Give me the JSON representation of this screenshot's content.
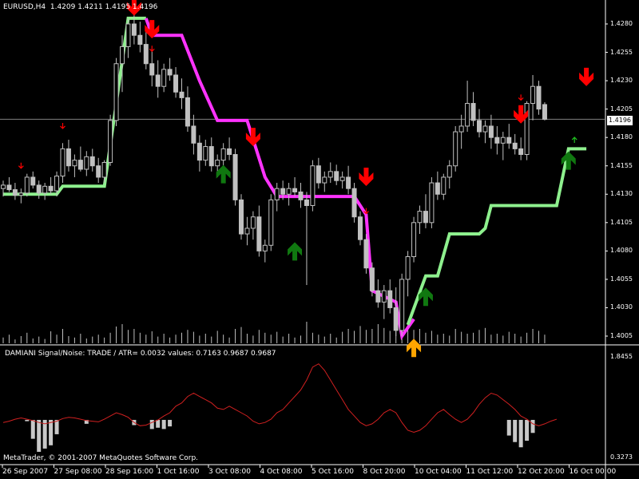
{
  "chart_data": {
    "type": "candlestick",
    "header": {
      "symbol": "EURUSD,H4",
      "ohlc": "1.4209 1.4211 1.4195 1.4196"
    },
    "current_price": "1.4196",
    "current_value": 1.4196,
    "price_axis": {
      "ticks": [
        "1.4280",
        "1.4255",
        "1.4230",
        "1.4205",
        "1.4180",
        "1.4155",
        "1.4130",
        "1.4105",
        "1.4080",
        "1.4055",
        "1.4030",
        "1.4005"
      ],
      "values": [
        1.428,
        1.4255,
        1.423,
        1.4205,
        1.418,
        1.4155,
        1.413,
        1.4105,
        1.408,
        1.4055,
        1.403,
        1.4005
      ]
    },
    "time_axis": [
      "26 Sep 2007",
      "27 Sep 08:00",
      "28 Sep 16:00",
      "1 Oct 16:00",
      "3 Oct 08:00",
      "4 Oct 08:00",
      "5 Oct 16:00",
      "8 Oct 20:00",
      "10 Oct 04:00",
      "11 Oct 12:00",
      "12 Oct 20:00",
      "16 Oct 00:00"
    ],
    "candles": [
      [
        1.4135,
        1.4142,
        1.4128,
        1.4138
      ],
      [
        1.4138,
        1.4145,
        1.4132,
        1.4134
      ],
      [
        1.4134,
        1.414,
        1.4125,
        1.4129
      ],
      [
        1.4129,
        1.4135,
        1.4122,
        1.4131
      ],
      [
        1.4131,
        1.4148,
        1.4128,
        1.4145
      ],
      [
        1.4145,
        1.415,
        1.4135,
        1.4138
      ],
      [
        1.4138,
        1.4142,
        1.4126,
        1.4131
      ],
      [
        1.4131,
        1.414,
        1.4125,
        1.4137
      ],
      [
        1.4137,
        1.4145,
        1.413,
        1.4133
      ],
      [
        1.4133,
        1.415,
        1.4128,
        1.4146
      ],
      [
        1.4146,
        1.4175,
        1.414,
        1.417
      ],
      [
        1.417,
        1.4178,
        1.415,
        1.4155
      ],
      [
        1.4155,
        1.4165,
        1.4145,
        1.416
      ],
      [
        1.416,
        1.4172,
        1.415,
        1.4152
      ],
      [
        1.4152,
        1.4168,
        1.4146,
        1.4163
      ],
      [
        1.4163,
        1.417,
        1.415,
        1.4155
      ],
      [
        1.4155,
        1.4162,
        1.414,
        1.4145
      ],
      [
        1.4145,
        1.416,
        1.414,
        1.4158
      ],
      [
        1.4158,
        1.42,
        1.4155,
        1.4195
      ],
      [
        1.4195,
        1.425,
        1.419,
        1.4245
      ],
      [
        1.4245,
        1.427,
        1.422,
        1.426
      ],
      [
        1.426,
        1.4285,
        1.425,
        1.428
      ],
      [
        1.428,
        1.429,
        1.4262,
        1.427
      ],
      [
        1.427,
        1.4282,
        1.4255,
        1.4262
      ],
      [
        1.4262,
        1.4275,
        1.424,
        1.4245
      ],
      [
        1.4245,
        1.4258,
        1.4225,
        1.4235
      ],
      [
        1.4235,
        1.4248,
        1.4215,
        1.4225
      ],
      [
        1.4225,
        1.4245,
        1.422,
        1.424
      ],
      [
        1.424,
        1.425,
        1.423,
        1.4235
      ],
      [
        1.4235,
        1.4242,
        1.4215,
        1.422
      ],
      [
        1.422,
        1.4232,
        1.4205,
        1.4215
      ],
      [
        1.4215,
        1.4225,
        1.4185,
        1.419
      ],
      [
        1.419,
        1.42,
        1.4165,
        1.4175
      ],
      [
        1.4175,
        1.4182,
        1.415,
        1.416
      ],
      [
        1.416,
        1.4178,
        1.4155,
        1.4172
      ],
      [
        1.4172,
        1.418,
        1.415,
        1.4155
      ],
      [
        1.4155,
        1.4165,
        1.4145,
        1.416
      ],
      [
        1.416,
        1.4175,
        1.4155,
        1.417
      ],
      [
        1.417,
        1.418,
        1.416,
        1.4165
      ],
      [
        1.4165,
        1.417,
        1.412,
        1.4125
      ],
      [
        1.4125,
        1.413,
        1.409,
        1.4095
      ],
      [
        1.4095,
        1.411,
        1.4085,
        1.41
      ],
      [
        1.41,
        1.4115,
        1.409,
        1.411
      ],
      [
        1.411,
        1.412,
        1.4075,
        1.408
      ],
      [
        1.408,
        1.409,
        1.407,
        1.4085
      ],
      [
        1.4085,
        1.413,
        1.408,
        1.4125
      ],
      [
        1.4125,
        1.414,
        1.4115,
        1.4135
      ],
      [
        1.4135,
        1.4142,
        1.4125,
        1.413
      ],
      [
        1.413,
        1.414,
        1.412,
        1.4135
      ],
      [
        1.4135,
        1.4145,
        1.4128,
        1.4132
      ],
      [
        1.4132,
        1.414,
        1.4118,
        1.4125
      ],
      [
        1.4125,
        1.4132,
        1.405,
        1.412
      ],
      [
        1.412,
        1.416,
        1.4115,
        1.4155
      ],
      [
        1.4155,
        1.4162,
        1.4135,
        1.414
      ],
      [
        1.414,
        1.415,
        1.4132,
        1.4145
      ],
      [
        1.4145,
        1.4158,
        1.414,
        1.415
      ],
      [
        1.415,
        1.4156,
        1.4138,
        1.4142
      ],
      [
        1.4142,
        1.415,
        1.4135,
        1.4145
      ],
      [
        1.4145,
        1.4155,
        1.413,
        1.4135
      ],
      [
        1.4135,
        1.414,
        1.4105,
        1.411
      ],
      [
        1.411,
        1.4115,
        1.4085,
        1.409
      ],
      [
        1.409,
        1.4095,
        1.406,
        1.4065
      ],
      [
        1.4065,
        1.407,
        1.404,
        1.4045
      ],
      [
        1.4045,
        1.4055,
        1.403,
        1.4035
      ],
      [
        1.4035,
        1.405,
        1.402,
        1.4045
      ],
      [
        1.4045,
        1.4055,
        1.4025,
        1.403
      ],
      [
        1.403,
        1.4048,
        1.4005,
        1.401
      ],
      [
        1.401,
        1.406,
        1.4005,
        1.4055
      ],
      [
        1.4055,
        1.408,
        1.404,
        1.4075
      ],
      [
        1.4075,
        1.411,
        1.407,
        1.4105
      ],
      [
        1.4105,
        1.412,
        1.4095,
        1.4115
      ],
      [
        1.4115,
        1.413,
        1.41,
        1.4105
      ],
      [
        1.4105,
        1.4145,
        1.41,
        1.414
      ],
      [
        1.414,
        1.415,
        1.4125,
        1.413
      ],
      [
        1.413,
        1.4148,
        1.4125,
        1.4145
      ],
      [
        1.4145,
        1.416,
        1.4135,
        1.4155
      ],
      [
        1.4155,
        1.419,
        1.415,
        1.4185
      ],
      [
        1.4185,
        1.42,
        1.417,
        1.419
      ],
      [
        1.419,
        1.423,
        1.4185,
        1.421
      ],
      [
        1.421,
        1.422,
        1.419,
        1.4195
      ],
      [
        1.4195,
        1.4205,
        1.418,
        1.4185
      ],
      [
        1.4185,
        1.4195,
        1.4175,
        1.419
      ],
      [
        1.419,
        1.42,
        1.417,
        1.418
      ],
      [
        1.418,
        1.419,
        1.4165,
        1.4175
      ],
      [
        1.4175,
        1.4185,
        1.416,
        1.418
      ],
      [
        1.418,
        1.4192,
        1.417,
        1.4175
      ],
      [
        1.4175,
        1.4183,
        1.4165,
        1.417
      ],
      [
        1.417,
        1.418,
        1.416,
        1.4165
      ],
      [
        1.4165,
        1.4212,
        1.416,
        1.421
      ],
      [
        1.421,
        1.4235,
        1.4195,
        1.4225
      ],
      [
        1.4225,
        1.423,
        1.42,
        1.4205
      ],
      [
        1.4209,
        1.4211,
        1.4195,
        1.4196
      ]
    ],
    "stop_lines": [
      {
        "name": "support",
        "color": "#8ef08e",
        "points": [
          [
            0,
            1.413
          ],
          [
            9,
            1.413
          ],
          [
            10,
            1.4137
          ],
          [
            17,
            1.4137
          ],
          [
            19,
            1.421
          ],
          [
            21,
            1.4285
          ],
          [
            24,
            1.4285
          ]
        ]
      },
      {
        "name": "resistance",
        "color": "#ff33ff",
        "points": [
          [
            24,
            1.4285
          ],
          [
            25,
            1.427
          ],
          [
            30,
            1.427
          ],
          [
            33,
            1.423
          ],
          [
            36,
            1.4195
          ],
          [
            41,
            1.4195
          ],
          [
            44,
            1.4145
          ],
          [
            46,
            1.4128
          ],
          [
            59,
            1.4128
          ],
          [
            61,
            1.4112
          ],
          [
            62,
            1.4045
          ],
          [
            66,
            1.4035
          ],
          [
            67,
            1.4005
          ],
          [
            69,
            1.402
          ]
        ]
      },
      {
        "name": "support2",
        "color": "#8ef08e",
        "points": [
          [
            68,
            1.4015
          ],
          [
            71,
            1.4058
          ],
          [
            73,
            1.4058
          ],
          [
            75,
            1.4095
          ],
          [
            80,
            1.4095
          ],
          [
            81,
            1.41
          ],
          [
            82,
            1.412
          ],
          [
            93,
            1.412
          ],
          [
            95,
            1.417
          ],
          [
            98,
            1.417
          ]
        ]
      }
    ],
    "signals": [
      {
        "i": 3,
        "type": "sell-small",
        "price": 1.4155
      },
      {
        "i": 10,
        "type": "sell-small",
        "price": 1.419
      },
      {
        "i": 22,
        "type": "sell",
        "price": 1.4295
      },
      {
        "i": 25,
        "type": "sell",
        "price": 1.4275
      },
      {
        "i": 25,
        "type": "sell-small",
        "price": 1.4258
      },
      {
        "i": 37,
        "type": "buy",
        "price": 1.4148
      },
      {
        "i": 42,
        "type": "sell",
        "price": 1.418
      },
      {
        "i": 49,
        "type": "buy",
        "price": 1.408
      },
      {
        "i": 61,
        "type": "sell",
        "price": 1.4145
      },
      {
        "i": 61,
        "type": "sell-small",
        "price": 1.4115
      },
      {
        "i": 69,
        "type": "buy-orange",
        "price": 1.3995
      },
      {
        "i": 71,
        "type": "buy",
        "price": 1.404
      },
      {
        "i": 87,
        "type": "sell-small",
        "price": 1.4215
      },
      {
        "i": 87,
        "type": "sell",
        "price": 1.42
      },
      {
        "i": 95,
        "type": "buy",
        "price": 1.416
      },
      {
        "i": 96,
        "type": "buy-small",
        "price": 1.4178
      },
      {
        "i": 98,
        "type": "sell",
        "price": 1.4233
      }
    ],
    "volume": [
      12,
      18,
      8,
      15,
      22,
      10,
      14,
      9,
      25,
      18,
      30,
      15,
      12,
      20,
      10,
      14,
      18,
      12,
      22,
      35,
      40,
      28,
      30,
      22,
      18,
      25,
      14,
      20,
      12,
      18,
      22,
      28,
      24,
      16,
      20,
      14,
      26,
      18,
      12,
      30,
      34,
      20,
      16,
      28,
      22,
      18,
      24,
      14,
      20,
      12,
      16,
      45,
      22,
      18,
      14,
      20,
      12,
      24,
      30,
      26,
      36,
      28,
      30,
      40,
      32,
      26,
      34,
      38,
      40,
      28,
      30,
      22,
      26,
      18,
      20,
      16,
      30,
      24,
      20,
      22,
      28,
      32,
      18,
      20,
      16,
      24,
      20,
      14,
      22,
      30,
      26,
      18,
      12,
      10
    ],
    "indicator": {
      "title": "DAMIANI Signal/Noise: TRADE  /  ATR= 0.0032     values: 0.7163 0.9687 0.9687",
      "ticks": [
        "1.8455",
        "0.3273"
      ],
      "range": [
        0.3273,
        1.8455
      ],
      "line_color": "#d02020",
      "line": [
        0.9,
        0.92,
        0.95,
        0.97,
        0.95,
        0.93,
        0.9,
        0.88,
        0.9,
        0.92,
        0.96,
        0.98,
        0.97,
        0.95,
        0.93,
        0.92,
        0.91,
        0.95,
        1.0,
        1.05,
        1.02,
        0.98,
        0.9,
        0.85,
        0.86,
        0.9,
        0.94,
        1.0,
        1.05,
        1.15,
        1.2,
        1.3,
        1.35,
        1.3,
        1.25,
        1.2,
        1.12,
        1.1,
        1.15,
        1.1,
        1.05,
        1.0,
        0.92,
        0.88,
        0.9,
        0.95,
        1.05,
        1.1,
        1.2,
        1.3,
        1.4,
        1.55,
        1.75,
        1.8,
        1.7,
        1.55,
        1.4,
        1.25,
        1.1,
        1.0,
        0.9,
        0.85,
        0.88,
        0.95,
        1.05,
        1.1,
        1.05,
        0.9,
        0.78,
        0.75,
        0.78,
        0.85,
        0.95,
        1.05,
        1.1,
        1.02,
        0.95,
        0.9,
        0.95,
        1.05,
        1.18,
        1.28,
        1.35,
        1.32,
        1.25,
        1.18,
        1.1,
        1.0,
        0.95,
        0.88,
        0.85,
        0.88,
        0.92,
        0.95
      ],
      "bars": [
        {
          "i": 4,
          "v": 0.92
        },
        {
          "i": 5,
          "v": 0.65
        },
        {
          "i": 6,
          "v": 0.45
        },
        {
          "i": 7,
          "v": 0.5
        },
        {
          "i": 8,
          "v": 0.55
        },
        {
          "i": 9,
          "v": 0.72
        },
        {
          "i": 14,
          "v": 0.88
        },
        {
          "i": 22,
          "v": 0.86
        },
        {
          "i": 25,
          "v": 0.8
        },
        {
          "i": 26,
          "v": 0.82
        },
        {
          "i": 27,
          "v": 0.8
        },
        {
          "i": 28,
          "v": 0.84
        },
        {
          "i": 85,
          "v": 0.7
        },
        {
          "i": 86,
          "v": 0.6
        },
        {
          "i": 87,
          "v": 0.52
        },
        {
          "i": 88,
          "v": 0.62
        },
        {
          "i": 89,
          "v": 0.74
        }
      ]
    }
  },
  "footer": {
    "copyright": "MetaTrader, © 2001-2007 MetaQuotes Software Corp."
  },
  "colors": {
    "candle": "#c0c0c0",
    "buy_arrow": "#107810",
    "sell_arrow": "#ff0000",
    "buy_orange": "#ffa500",
    "grid_line": "#808080"
  }
}
